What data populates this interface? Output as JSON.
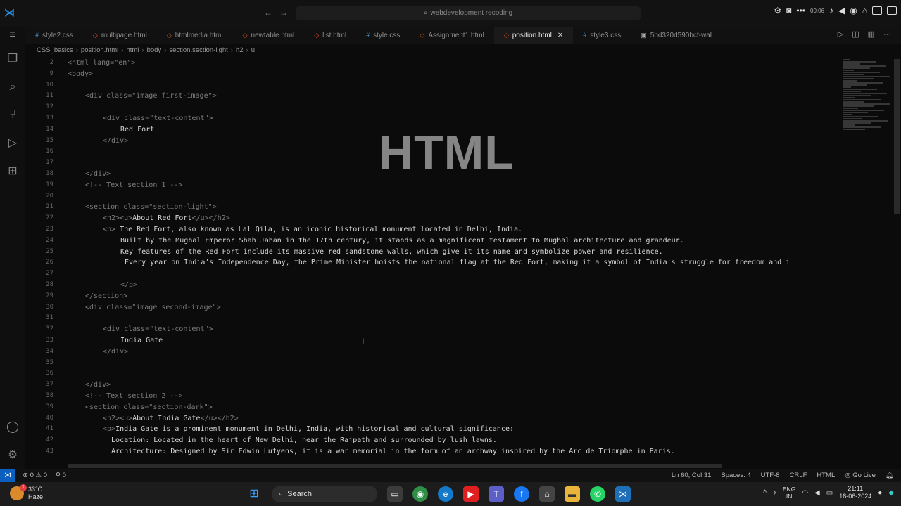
{
  "titlebar": {
    "search_text": "webdevelopment recoding",
    "clock_mini": "00:06"
  },
  "tabs": [
    {
      "label": "style2.css",
      "color": "#4b9fd8",
      "dot": "#"
    },
    {
      "label": "multipage.html",
      "color": "#e44d26",
      "dot": "◇"
    },
    {
      "label": "htmlmedia.html",
      "color": "#e44d26",
      "dot": "◇"
    },
    {
      "label": "newtable.html",
      "color": "#e44d26",
      "dot": "◇"
    },
    {
      "label": "list.html",
      "color": "#e44d26",
      "dot": "◇"
    },
    {
      "label": "style.css",
      "color": "#4b9fd8",
      "dot": "#"
    },
    {
      "label": "Assignment1.html",
      "color": "#e44d26",
      "dot": "◇"
    },
    {
      "label": "position.html",
      "color": "#e44d26",
      "dot": "◇",
      "active": true
    },
    {
      "label": "style3.css",
      "color": "#4b9fd8",
      "dot": "#"
    },
    {
      "label": "5bd320d590bcf-wal",
      "color": "#aaaaaa",
      "dot": "▣"
    }
  ],
  "breadcrumb": [
    "CSS_basics",
    "position.html",
    "html",
    "body",
    "section.section-light",
    "h2",
    "u"
  ],
  "editor": {
    "watermark": "HTML",
    "lines": [
      {
        "n": "2",
        "indent": 0,
        "tag": "<html lang=\"en\">",
        "text": ""
      },
      {
        "n": "9",
        "indent": 0,
        "tag": "<body>",
        "text": ""
      },
      {
        "n": "10",
        "indent": 0,
        "tag": "",
        "text": ""
      },
      {
        "n": "11",
        "indent": 1,
        "tag": "<div class=\"image first-image\">",
        "text": ""
      },
      {
        "n": "12",
        "indent": 0,
        "tag": "",
        "text": ""
      },
      {
        "n": "13",
        "indent": 2,
        "tag": "<div class=\"text-content\">",
        "text": ""
      },
      {
        "n": "14",
        "indent": 3,
        "tag": "",
        "text": "Red Fort"
      },
      {
        "n": "15",
        "indent": 2,
        "tag": "</div>",
        "text": ""
      },
      {
        "n": "16",
        "indent": 0,
        "tag": "",
        "text": ""
      },
      {
        "n": "17",
        "indent": 0,
        "tag": "",
        "text": ""
      },
      {
        "n": "18",
        "indent": 1,
        "tag": "</div>",
        "text": ""
      },
      {
        "n": "19",
        "indent": 1,
        "tag": "<!-- Text section 1 -->",
        "text": ""
      },
      {
        "n": "20",
        "indent": 0,
        "tag": "",
        "text": ""
      },
      {
        "n": "21",
        "indent": 1,
        "tag": "<section class=\"section-light\">",
        "text": ""
      },
      {
        "n": "22",
        "indent": 2,
        "tag": "<h2><u>",
        "text": "About Red Fort",
        "tag2": "</u></h2>"
      },
      {
        "n": "23",
        "indent": 2,
        "tag": "<p> ",
        "text": "The Red Fort, also known as Lal Qila, is an iconic historical monument located in Delhi, India."
      },
      {
        "n": "24",
        "indent": 3,
        "tag": "",
        "text": "Built by the Mughal Emperor Shah Jahan in the 17th century, it stands as a magnificent testament to Mughal architecture and grandeur."
      },
      {
        "n": "25",
        "indent": 3,
        "tag": "",
        "text": "Key features of the Red Fort include its massive red sandstone walls, which give it its name and symbolize power and resilience."
      },
      {
        "n": "26",
        "indent": 3,
        "tag": "",
        "text": " Every year on India's Independence Day, the Prime Minister hoists the national flag at the Red Fort, making it a symbol of India's struggle for freedom and i"
      },
      {
        "n": "27",
        "indent": 0,
        "tag": "",
        "text": ""
      },
      {
        "n": "28",
        "indent": 3,
        "tag": "</p>",
        "text": ""
      },
      {
        "n": "29",
        "indent": 1,
        "tag": "</section>",
        "text": ""
      },
      {
        "n": "30",
        "indent": 1,
        "tag": "<div class=\"image second-image\">",
        "text": ""
      },
      {
        "n": "31",
        "indent": 0,
        "tag": "",
        "text": ""
      },
      {
        "n": "32",
        "indent": 2,
        "tag": "<div class=\"text-content\">",
        "text": ""
      },
      {
        "n": "33",
        "indent": 3,
        "tag": "",
        "text": "India Gate"
      },
      {
        "n": "34",
        "indent": 2,
        "tag": "</div>",
        "text": ""
      },
      {
        "n": "35",
        "indent": 0,
        "tag": "",
        "text": ""
      },
      {
        "n": "36",
        "indent": 0,
        "tag": "",
        "text": ""
      },
      {
        "n": "37",
        "indent": 1,
        "tag": "</div>",
        "text": ""
      },
      {
        "n": "38",
        "indent": 1,
        "tag": "<!-- Text section 2 -->",
        "text": ""
      },
      {
        "n": "39",
        "indent": 1,
        "tag": "<section class=\"section-dark\">",
        "text": ""
      },
      {
        "n": "40",
        "indent": 2,
        "tag": "<h2><u>",
        "text": "About India Gate",
        "tag2": "</u></h2>"
      },
      {
        "n": "41",
        "indent": 2,
        "tag": "<p>",
        "text": "India Gate is a prominent monument in Delhi, India, with historical and cultural significance:"
      },
      {
        "n": "42",
        "indent": 2,
        "tag": "",
        "text": "  Location: Located in the heart of New Delhi, near the Rajpath and surrounded by lush lawns."
      },
      {
        "n": "43",
        "indent": 2,
        "tag": "",
        "text": "  Architecture: Designed by Sir Edwin Lutyens, it is a war memorial in the form of an archway inspired by the Arc de Triomphe in Paris."
      }
    ]
  },
  "statusbar": {
    "errors": "0",
    "warnings": "0",
    "ports": "0",
    "position": "Ln 60, Col 31",
    "spaces": "Spaces: 4",
    "encoding": "UTF-8",
    "eol": "CRLF",
    "language": "HTML",
    "golive": "Go Live"
  },
  "taskbar": {
    "temperature": "33°C",
    "weather": "Haze",
    "badge": "1",
    "search": "Search",
    "lang_top": "ENG",
    "lang_bottom": "IN",
    "time": "21:11",
    "date": "18-06-2024"
  }
}
